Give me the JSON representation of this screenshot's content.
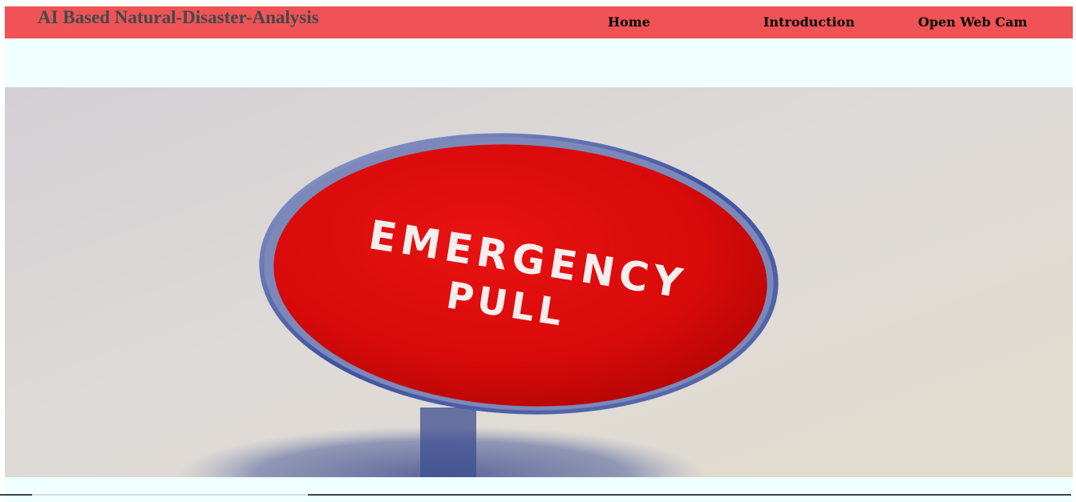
{
  "navbar": {
    "brand": "AI Based Natural-Disaster-Analysis",
    "links": [
      {
        "label": "Home"
      },
      {
        "label": "Introduction"
      },
      {
        "label": "Open Web Cam"
      }
    ]
  },
  "hero": {
    "image_text": [
      "EMERGENCY",
      "PULL"
    ],
    "button_color": "#d80a0a"
  },
  "colors": {
    "navbar_bg": "#f05355",
    "page_bg": "#f0ffff",
    "brand_text": "#3f4a4a"
  }
}
